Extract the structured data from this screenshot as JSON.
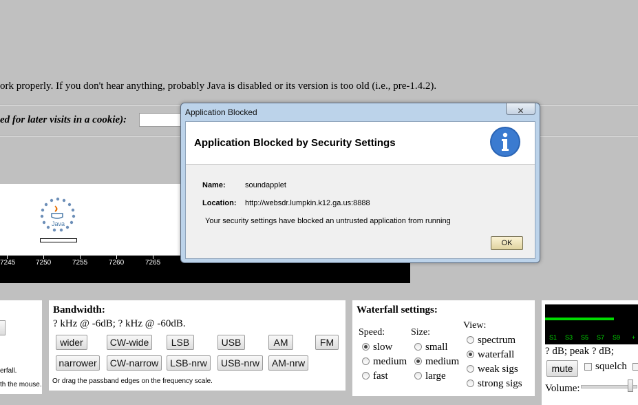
{
  "page": {
    "warning_text": "ork properly. If you don't hear anything, probably Java is disabled or its version is too old (i.e., pre-1.4.2).",
    "cookie_label": "ed for later visits in a cookie):",
    "cookie_input_value": ""
  },
  "java": {
    "logo_text": "Java"
  },
  "scale": {
    "ticks": [
      "7245",
      "7250",
      "7255",
      "7260",
      "7265"
    ]
  },
  "left_panel": {
    "line1": "erfall.",
    "line2": "th the mouse."
  },
  "bandwidth": {
    "title": "Bandwidth:",
    "status": "? kHz @ -6dB; ? kHz @ -60dB.",
    "buttons_row1": [
      "wider",
      "CW-wide",
      "LSB",
      "USB",
      "AM",
      "FM"
    ],
    "buttons_row2": [
      "narrower",
      "CW-narrow",
      "LSB-nrw",
      "USB-nrw",
      "AM-nrw"
    ],
    "hint": "Or drag the passband edges on the frequency scale."
  },
  "waterfall": {
    "title": "Waterfall settings:",
    "speed_label": "Speed:",
    "speed_options": [
      "slow",
      "medium",
      "fast"
    ],
    "speed_selected": "slow",
    "size_label": "Size:",
    "size_options": [
      "small",
      "medium",
      "large"
    ],
    "size_selected": "medium",
    "view_label": "View:",
    "view_options": [
      "spectrum",
      "waterfall",
      "weak sigs",
      "strong sigs"
    ],
    "view_selected": "waterfall"
  },
  "audio": {
    "smeter_labels": [
      "S1",
      "S3",
      "S5",
      "S7",
      "S9",
      "+"
    ],
    "smeter_level": 0.75,
    "db_text": "? dB; peak ? dB;",
    "mute_label": "mute",
    "squelch_label": "squelch",
    "volume_label": "Volume:",
    "volume_level": 0.95,
    "accent_color": "#00dd00"
  },
  "dialog": {
    "window_title": "Application Blocked",
    "heading": "Application Blocked by Security Settings",
    "name_label": "Name:",
    "name_value": "soundapplet",
    "location_label": "Location:",
    "location_value": "http://websdr.lumpkin.k12.ga.us:8888",
    "message": "Your security settings have blocked an untrusted application from running",
    "ok_label": "OK",
    "info_icon": "info-icon"
  }
}
